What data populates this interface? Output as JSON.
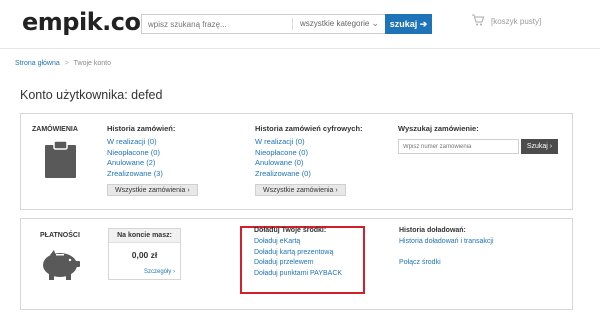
{
  "header": {
    "logo": "empik.com",
    "search_placeholder": "wpisz szukaną frazę...",
    "category": "wszystkie kategorie",
    "search_button": "szukaj ➔",
    "cart": "[koszyk pusty]"
  },
  "breadcrumb": {
    "home": "Strona główna",
    "separator": ">",
    "current": "Twoje konto"
  },
  "page_title": "Konto użytkownika: defed",
  "orders": {
    "label": "ZAMÓWIENIA",
    "history": {
      "title": "Historia zamówień:",
      "items": [
        "W realizacji (0)",
        "Nieopłacone (0)",
        "Anulowane (2)",
        "Zrealizowane (3)"
      ],
      "button": "Wszystkie zamówienia ›"
    },
    "digital": {
      "title": "Historia zamówień cyfrowych:",
      "items": [
        "W realizacji (0)",
        "Nieopłacone (0)",
        "Anulowane (0)",
        "Zrealizowane (0)"
      ],
      "button": "Wszystkie zamówienia ›"
    },
    "search": {
      "title": "Wyszukaj zamówienie:",
      "placeholder": "Wpisz numer zamówienia",
      "button": "Szukaj ›"
    }
  },
  "payments": {
    "label": "PŁATNOŚCI",
    "balance": {
      "title": "Na koncie masz:",
      "value": "0,00 zł",
      "more": "Szczegóły ›"
    },
    "topup": {
      "title": "Doładuj Twoje środki:",
      "items": [
        "Doładuj eKartą",
        "Doładuj kartą prezentową",
        "Doładuj przelewem",
        "Doładuj punktami PAYBACK"
      ]
    },
    "history": {
      "title": "Historia doładowań:",
      "link1": "Historia doładowań i transakcji",
      "link2": "Połącz środki"
    }
  },
  "colors": {
    "accent": "#1f73b7",
    "highlight": "#d1202c",
    "icon_grey": "#595959"
  }
}
